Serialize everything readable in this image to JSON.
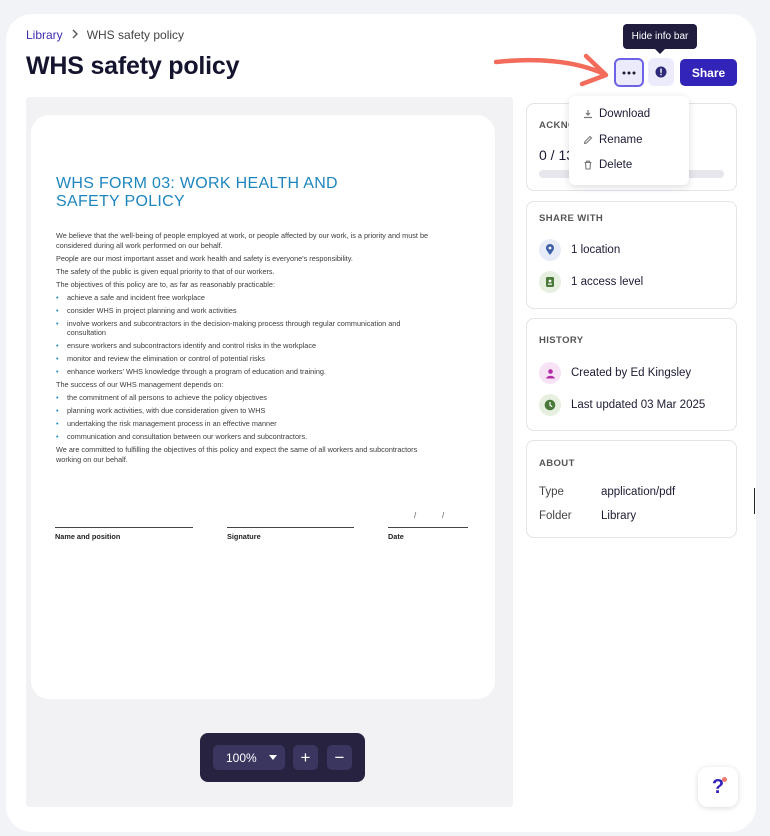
{
  "breadcrumb": {
    "parent": "Library",
    "separator": "›",
    "current": "WHS safety policy"
  },
  "page_title": "WHS safety policy",
  "toolbar": {
    "tooltip": "Hide info bar",
    "more_label": "···",
    "share_label": "Share"
  },
  "more_menu": {
    "items": [
      {
        "label": "Download",
        "icon": "download-icon"
      },
      {
        "label": "Rename",
        "icon": "pencil-icon"
      },
      {
        "label": "Delete",
        "icon": "trash-icon"
      }
    ]
  },
  "document": {
    "title": "WHS FORM 03: WORK HEALTH AND SAFETY POLICY",
    "p1": "We believe that the well-being of people employed at work, or people affected by our work, is a priority and must be considered during all work performed on our behalf.",
    "p2": "People are our most important asset and work health and safety is everyone's responsibility.",
    "p3": "The safety of the public is given equal priority to that of our workers.",
    "p4": "The objectives of this policy are to, as far as reasonably practicable:",
    "objectives": [
      "achieve a safe and incident free workplace",
      "consider WHS in project planning and work activities",
      "involve workers and subcontractors in the decision-making process through regular communication and consultation",
      "ensure workers and subcontractors identify and control risks in the workplace",
      "monitor and review the elimination or control of potential risks",
      "enhance workers' WHS knowledge through a program of education and training."
    ],
    "p5": "The success of our WHS management depends on:",
    "success": [
      "the commitment of all persons to achieve the policy objectives",
      "planning work activities, with due consideration given to WHS",
      "undertaking the risk management process in an effective manner",
      "communication and consultation between our workers and subcontractors."
    ],
    "p6": "We are committed to fulfilling the objectives of this policy and expect the same of all workers and subcontractors working on our behalf.",
    "sig_name": "Name and position",
    "sig_signature": "Signature",
    "sig_date": "Date",
    "date_slash": "/"
  },
  "zoom": {
    "value": "100%",
    "plus": "+",
    "minus": "−"
  },
  "ack_card": {
    "title": "ACKNO",
    "count": "0 / 13",
    "progress": 0
  },
  "share_card": {
    "title": "SHARE WITH",
    "location": "1 location",
    "access": "1 access level"
  },
  "history_card": {
    "title": "HISTORY",
    "created": "Created by Ed Kingsley",
    "updated": "Last updated 03 Mar 2025"
  },
  "about_card": {
    "title": "ABOUT",
    "type_label": "Type",
    "type_value": "application/pdf",
    "folder_label": "Folder",
    "folder_value": "Library"
  },
  "help": {
    "label": "?"
  },
  "colors": {
    "accent": "#3224b8",
    "doc_title": "#1e86bf",
    "arrow": "#f26b5b"
  }
}
